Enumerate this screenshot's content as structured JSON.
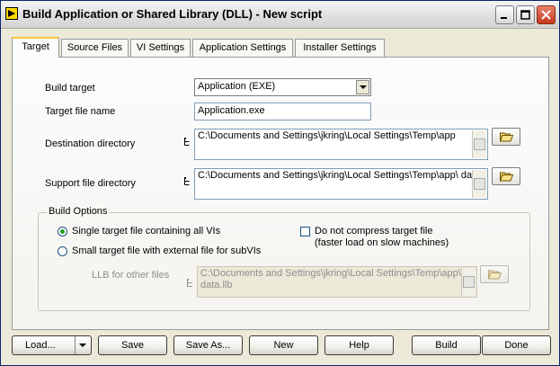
{
  "window": {
    "title": "Build Application or Shared Library (DLL) - New script"
  },
  "tabs": [
    {
      "label": "Target"
    },
    {
      "label": "Source Files"
    },
    {
      "label": "VI Settings"
    },
    {
      "label": "Application Settings"
    },
    {
      "label": "Installer Settings"
    }
  ],
  "target": {
    "build_target_label": "Build target",
    "build_target_value": "Application (EXE)",
    "target_file_name_label": "Target file name",
    "target_file_name_value": "Application.exe",
    "destination_dir_label": "Destination directory",
    "destination_dir_value": "C:\\Documents and Settings\\jkring\\Local Settings\\Temp\\app",
    "support_dir_label": "Support file directory",
    "support_dir_value": "C:\\Documents and Settings\\jkring\\Local Settings\\Temp\\app\\ data"
  },
  "build_options": {
    "title": "Build Options",
    "single_file_label": "Single target file containing all VIs",
    "single_file_checked": true,
    "small_file_label": "Small target file with external file for subVIs",
    "small_file_checked": false,
    "no_compress_label_1": "Do not compress target file",
    "no_compress_label_2": "(faster load on slow machines)",
    "no_compress_checked": false,
    "llb_label": "LLB for other files",
    "llb_value": "C:\\Documents and Settings\\jkring\\Local Settings\\Temp\\app\\ data.llb"
  },
  "buttons": {
    "load": "Load...",
    "save": "Save",
    "save_as": "Save As...",
    "new": "New",
    "help": "Help",
    "build": "Build",
    "done": "Done"
  },
  "icons": {
    "app": "labview-app-icon",
    "folder": "folder-open-icon",
    "path": "path-indicator-icon"
  }
}
